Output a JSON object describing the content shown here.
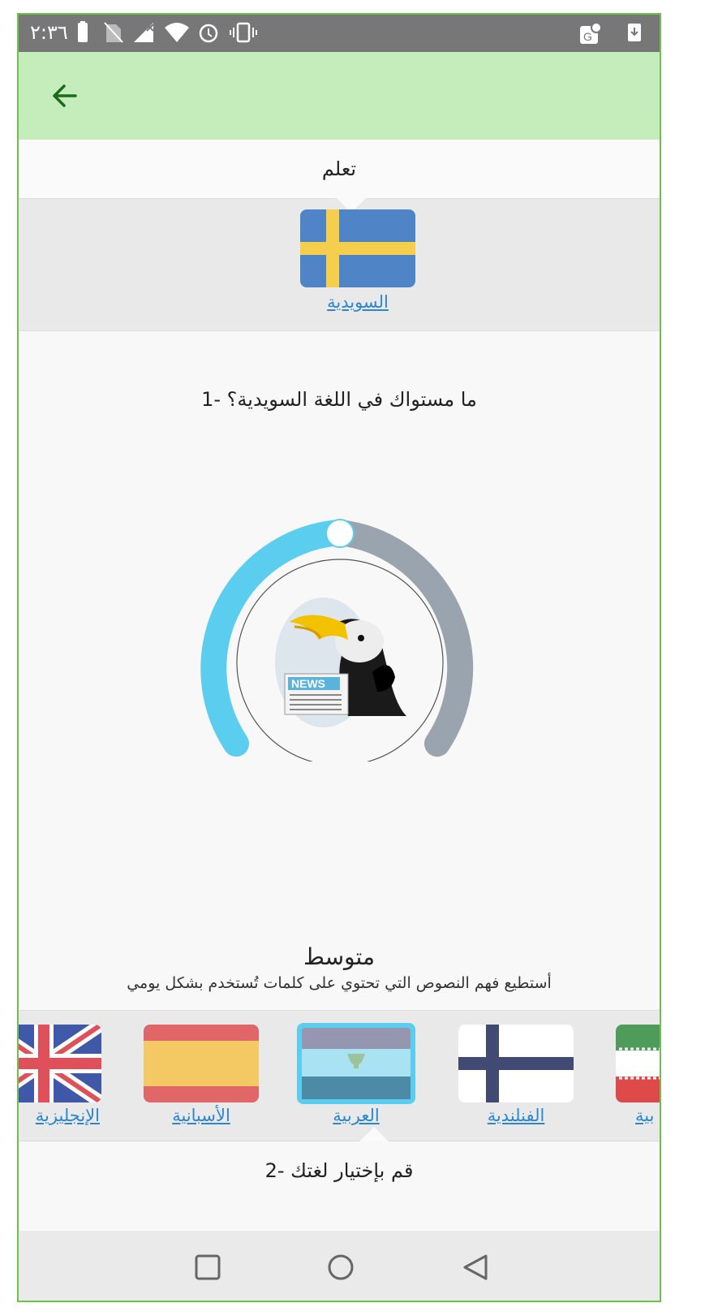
{
  "status": {
    "time": "٢:٣٦",
    "icons": [
      "battery-icon",
      "no-sim-icon",
      "signal-off-icon",
      "wifi-icon",
      "alarm-icon",
      "vibrate-icon",
      "maps-icon",
      "download-icon"
    ]
  },
  "appbar": {
    "back_icon": "arrow-back-icon"
  },
  "learn_label": "تعلم",
  "target_language": {
    "label": "السويدية",
    "flag": "sweden-flag"
  },
  "question": "ما مستواك في اللغة السويدية؟ -1",
  "level_dial": {
    "value_fraction": 0.5,
    "illustration": "toucan-news-icon",
    "colors": {
      "active": "#5bcdef",
      "inactive": "#9aa4ae"
    }
  },
  "level": {
    "title": "متوسط",
    "description": "أستطيع فهم النصوص التي تحتوي على كلمات تُستخدم بشكل يومي"
  },
  "native_languages": [
    {
      "label": "الإنجليزية",
      "flag": "uk-flag",
      "selected": false
    },
    {
      "label": "الأسبانية",
      "flag": "spain-flag",
      "selected": false
    },
    {
      "label": "العربية",
      "flag": "arabic-flag",
      "selected": true
    },
    {
      "label": "الفنلندية",
      "flag": "finland-flag",
      "selected": false
    },
    {
      "label": "بية",
      "flag": "iran-flag",
      "selected": false
    }
  ],
  "choose_label": "قم بإختيار لغتك -2",
  "navbar": {
    "buttons": [
      "recents-icon",
      "home-icon",
      "back-triangle-icon"
    ]
  },
  "colors": {
    "accent_green": "#c5edbc",
    "link_blue": "#2c86d4",
    "border_green": "#6cc24a"
  }
}
